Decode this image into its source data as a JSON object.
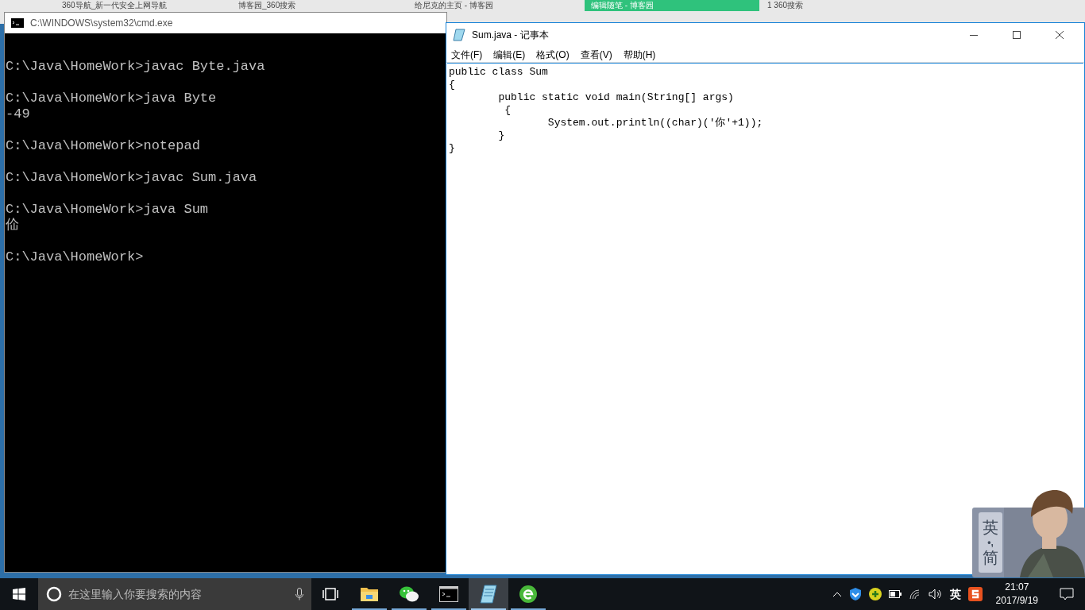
{
  "browser_tabs": [
    {
      "label": "360导航_新一代安全上网导航",
      "selected": false
    },
    {
      "label": "博客园_360搜索",
      "selected": false
    },
    {
      "label": "给尼克的主页 - 博客园",
      "selected": false
    },
    {
      "label": "编辑随笔 - 博客园",
      "selected": true
    },
    {
      "label": "1 360搜索",
      "selected": false
    }
  ],
  "cmd": {
    "title": "C:\\WINDOWS\\system32\\cmd.exe",
    "lines": [
      {
        "kind": "blank"
      },
      {
        "kind": "text",
        "text": "C:\\Java\\HomeWork>javac Byte.java"
      },
      {
        "kind": "blank"
      },
      {
        "kind": "text",
        "text": "C:\\Java\\HomeWork>java Byte"
      },
      {
        "kind": "text",
        "text": "-49"
      },
      {
        "kind": "blank"
      },
      {
        "kind": "text",
        "text": "C:\\Java\\HomeWork>notepad"
      },
      {
        "kind": "blank"
      },
      {
        "kind": "text",
        "text": "C:\\Java\\HomeWork>javac Sum.java"
      },
      {
        "kind": "blank"
      },
      {
        "kind": "text",
        "text": "C:\\Java\\HomeWork>java Sum"
      },
      {
        "kind": "text",
        "text": "佡"
      },
      {
        "kind": "blank"
      },
      {
        "kind": "text",
        "text": "C:\\Java\\HomeWork>"
      }
    ]
  },
  "notepad": {
    "title": "Sum.java - 记事本",
    "menu": [
      "文件(F)",
      "编辑(E)",
      "格式(O)",
      "查看(V)",
      "帮助(H)"
    ],
    "lines": [
      "public class Sum",
      "{",
      "\tpublic static void main(String[] args)",
      "\t {",
      "\t\tSystem.out.println((char)('你'+1));",
      "\t}",
      "}"
    ]
  },
  "ime": {
    "top": "英",
    "mark": "•,",
    "bottom": "简"
  },
  "taskbar": {
    "search": {
      "placeholder": "在这里输入你要搜索的内容"
    },
    "apps": [
      {
        "kind": "folder",
        "selected": false
      },
      {
        "kind": "wechat",
        "selected": false
      },
      {
        "kind": "cmd",
        "selected": false
      },
      {
        "kind": "notepad",
        "selected": true
      },
      {
        "kind": "browser",
        "selected": false
      }
    ],
    "ime_label": "英",
    "time": "21:07",
    "date": "2017/9/19"
  }
}
